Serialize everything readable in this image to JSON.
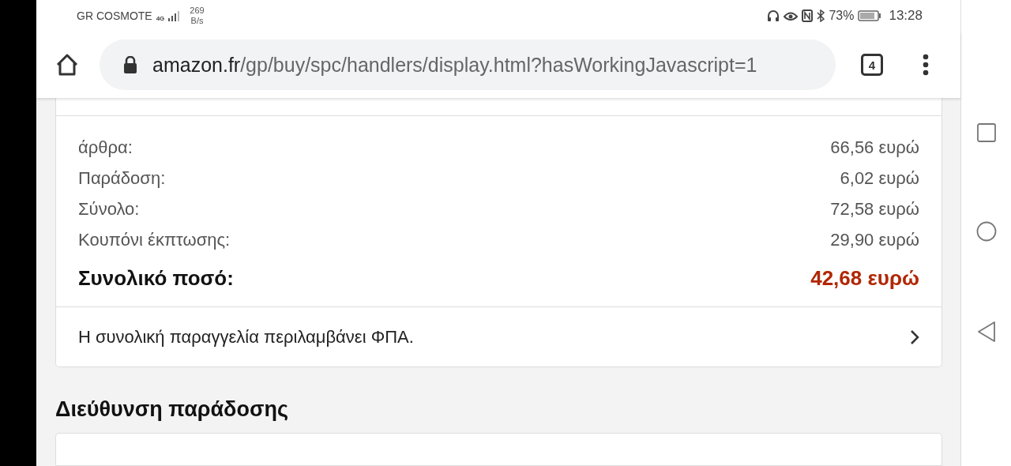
{
  "status_bar": {
    "carrier": "GR COSMOTE",
    "network": "4G",
    "speed_value": "269",
    "speed_unit": "B/s",
    "battery": "73%",
    "time": "13:28"
  },
  "toolbar": {
    "url_host": "amazon.fr",
    "url_path": "/gp/buy/spc/handlers/display.html?hasWorkingJavascript=1",
    "tab_count": "4"
  },
  "summary": {
    "lines": [
      {
        "label": "άρθρα:",
        "value": "66,56 ευρώ"
      },
      {
        "label": "Παράδοση:",
        "value": "6,02 ευρώ"
      },
      {
        "label": "Σύνολο:",
        "value": "72,58 ευρώ"
      },
      {
        "label": "Κουπόνι έκπτωσης:",
        "value": "29,90 ευρώ"
      }
    ],
    "total_label": "Συνολικό ποσό:",
    "total_value": "42,68 ευρώ",
    "vat_note": "Η συνολική παραγγελία περιλαμβάνει ΦΠΑ."
  },
  "delivery": {
    "heading": "Διεύθυνση παράδοσης"
  }
}
